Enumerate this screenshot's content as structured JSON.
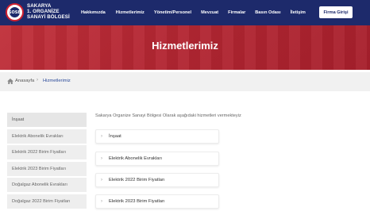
{
  "brand": {
    "logo_letters": "SOSB",
    "line1": "SAKARYA",
    "line2": "1. ORGANİZE",
    "line3": "SANAYİ BÖLGESİ"
  },
  "nav": {
    "items": [
      {
        "label": "Hakkımızda"
      },
      {
        "label": "Hizmetlerimiz"
      },
      {
        "label": "Yönetim/Personel"
      },
      {
        "label": "Mevzuat"
      },
      {
        "label": "Firmalar"
      },
      {
        "label": "Basın Odası"
      },
      {
        "label": "İletişim"
      }
    ],
    "cta_label": "Firma Girişi"
  },
  "hero": {
    "title": "Hizmetlerimiz"
  },
  "breadcrumb": {
    "home": "Anasayfa",
    "separator": "›",
    "current": "Hizmetlerimiz"
  },
  "sidebar": {
    "items": [
      {
        "label": "İnşaat"
      },
      {
        "label": "Elektrik Abonelik Evrakları"
      },
      {
        "label": "Elektrik 2022 Birim Fiyatları"
      },
      {
        "label": "Elektrik 2023 Birim Fiyatları"
      },
      {
        "label": "Doğalgaz Abonelik Evrakları"
      },
      {
        "label": "Doğalgaz 2022 Birim Fiyatları"
      }
    ]
  },
  "main": {
    "intro": "Sakarya Organize Sanayi Bölgesi Olarak aşağıdaki hizmetleri vermekteyiz",
    "accordion": [
      {
        "label": "İnşaat"
      },
      {
        "label": "Elektrik Abonelik Evrakları"
      },
      {
        "label": "Elektrik 2022 Birim Fiyatları"
      },
      {
        "label": "Elektrik 2023 Birim Fiyatları"
      }
    ]
  },
  "colors": {
    "header": "#1d2a6b",
    "hero": "#b42733",
    "link": "#2b4a9a"
  }
}
